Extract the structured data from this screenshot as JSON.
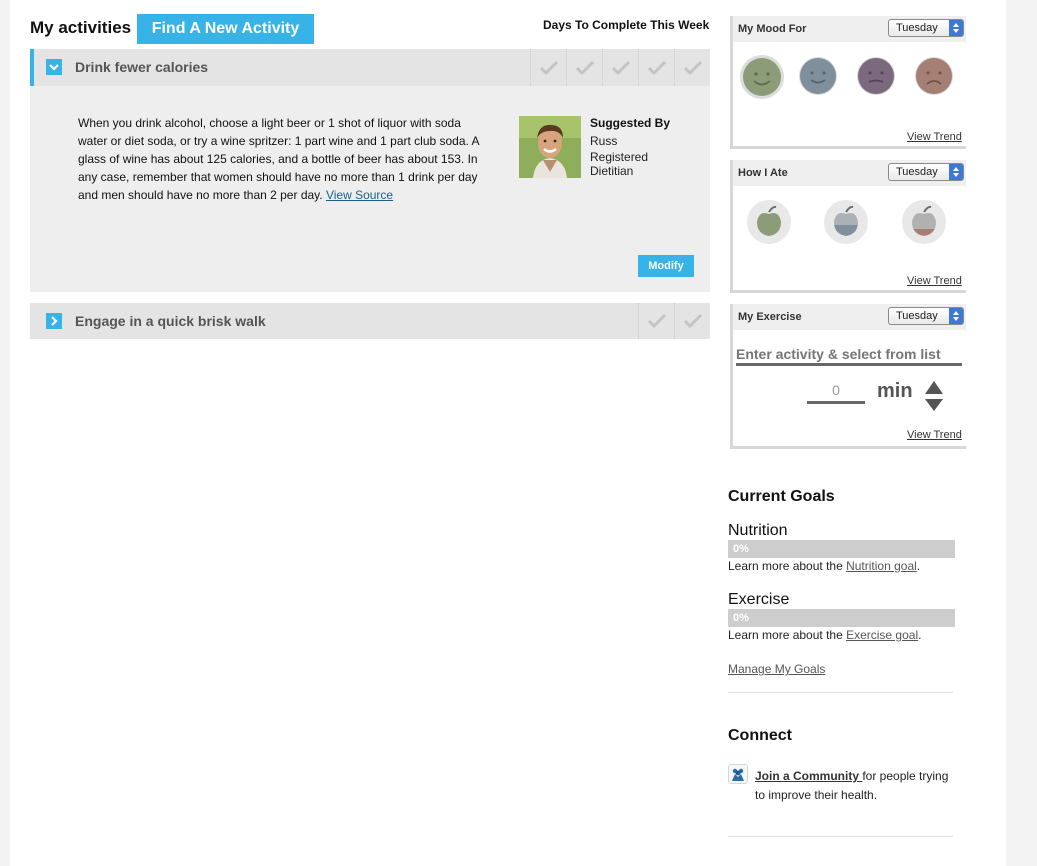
{
  "header": {
    "title": "My activities",
    "find_button": "Find A New Activity",
    "days_label": "Days To Complete This Week"
  },
  "activities": [
    {
      "name": "Drink fewer calories",
      "expanded": true,
      "description": "When you drink alcohol, choose a light beer or 1 shot of liquor with soda water or diet soda, or try a wine spritzer: 1 part wine and 1 part club soda. A glass of wine has about 125 calories, and a bottle of beer has about 153. In any case, remember that women should have no more than 1 drink per day and men should have no more than 2 per day.",
      "view_source": "View Source",
      "suggested_by_label": "Suggested By",
      "suggested_by_name": "Russ",
      "suggested_by_role_line1": "Registered",
      "suggested_by_role_line2": "Dietitian",
      "modify_label": "Modify",
      "day_checks": 5
    },
    {
      "name": "Engage in a quick brisk walk",
      "expanded": false,
      "day_checks": 2
    }
  ],
  "mood_widget": {
    "title": "My Mood For",
    "day": "Tuesday",
    "faces": [
      "very-happy-face-icon",
      "happy-face-icon",
      "neutral-face-icon",
      "sad-face-icon"
    ],
    "face_colors": [
      "#8c9c78",
      "#7f8f9b",
      "#7b6a7d",
      "#a57f73"
    ],
    "view_trend": "View Trend"
  },
  "ate_widget": {
    "title": "How I Ate",
    "day": "Tuesday",
    "apples": [
      "full-apple-icon",
      "half-apple-icon",
      "low-apple-icon"
    ],
    "view_trend": "View Trend"
  },
  "exercise_widget": {
    "title": "My Exercise",
    "day": "Tuesday",
    "activity_placeholder": "Enter activity & select from list",
    "minutes_value": "0",
    "minutes_unit": "min",
    "view_trend": "View Trend"
  },
  "goals": {
    "heading": "Current Goals",
    "items": [
      {
        "name": "Nutrition",
        "percent_label": "0%",
        "progress": 0,
        "learn_prefix": "Learn more about the ",
        "learn_link": "Nutrition goal",
        "learn_suffix": "."
      },
      {
        "name": "Exercise",
        "percent_label": "0%",
        "progress": 0,
        "learn_prefix": "Learn more about the ",
        "learn_link": "Exercise goal",
        "learn_suffix": "."
      }
    ],
    "manage_link": "Manage My Goals"
  },
  "connect": {
    "heading": "Connect",
    "join_link": "Join a Community ",
    "join_text_line1": "for people trying",
    "join_text_line2": "to improve their health."
  },
  "colors": {
    "accent": "#37b3e8",
    "header_bar": "#e4e4e4",
    "panel": "#eeeeee"
  }
}
